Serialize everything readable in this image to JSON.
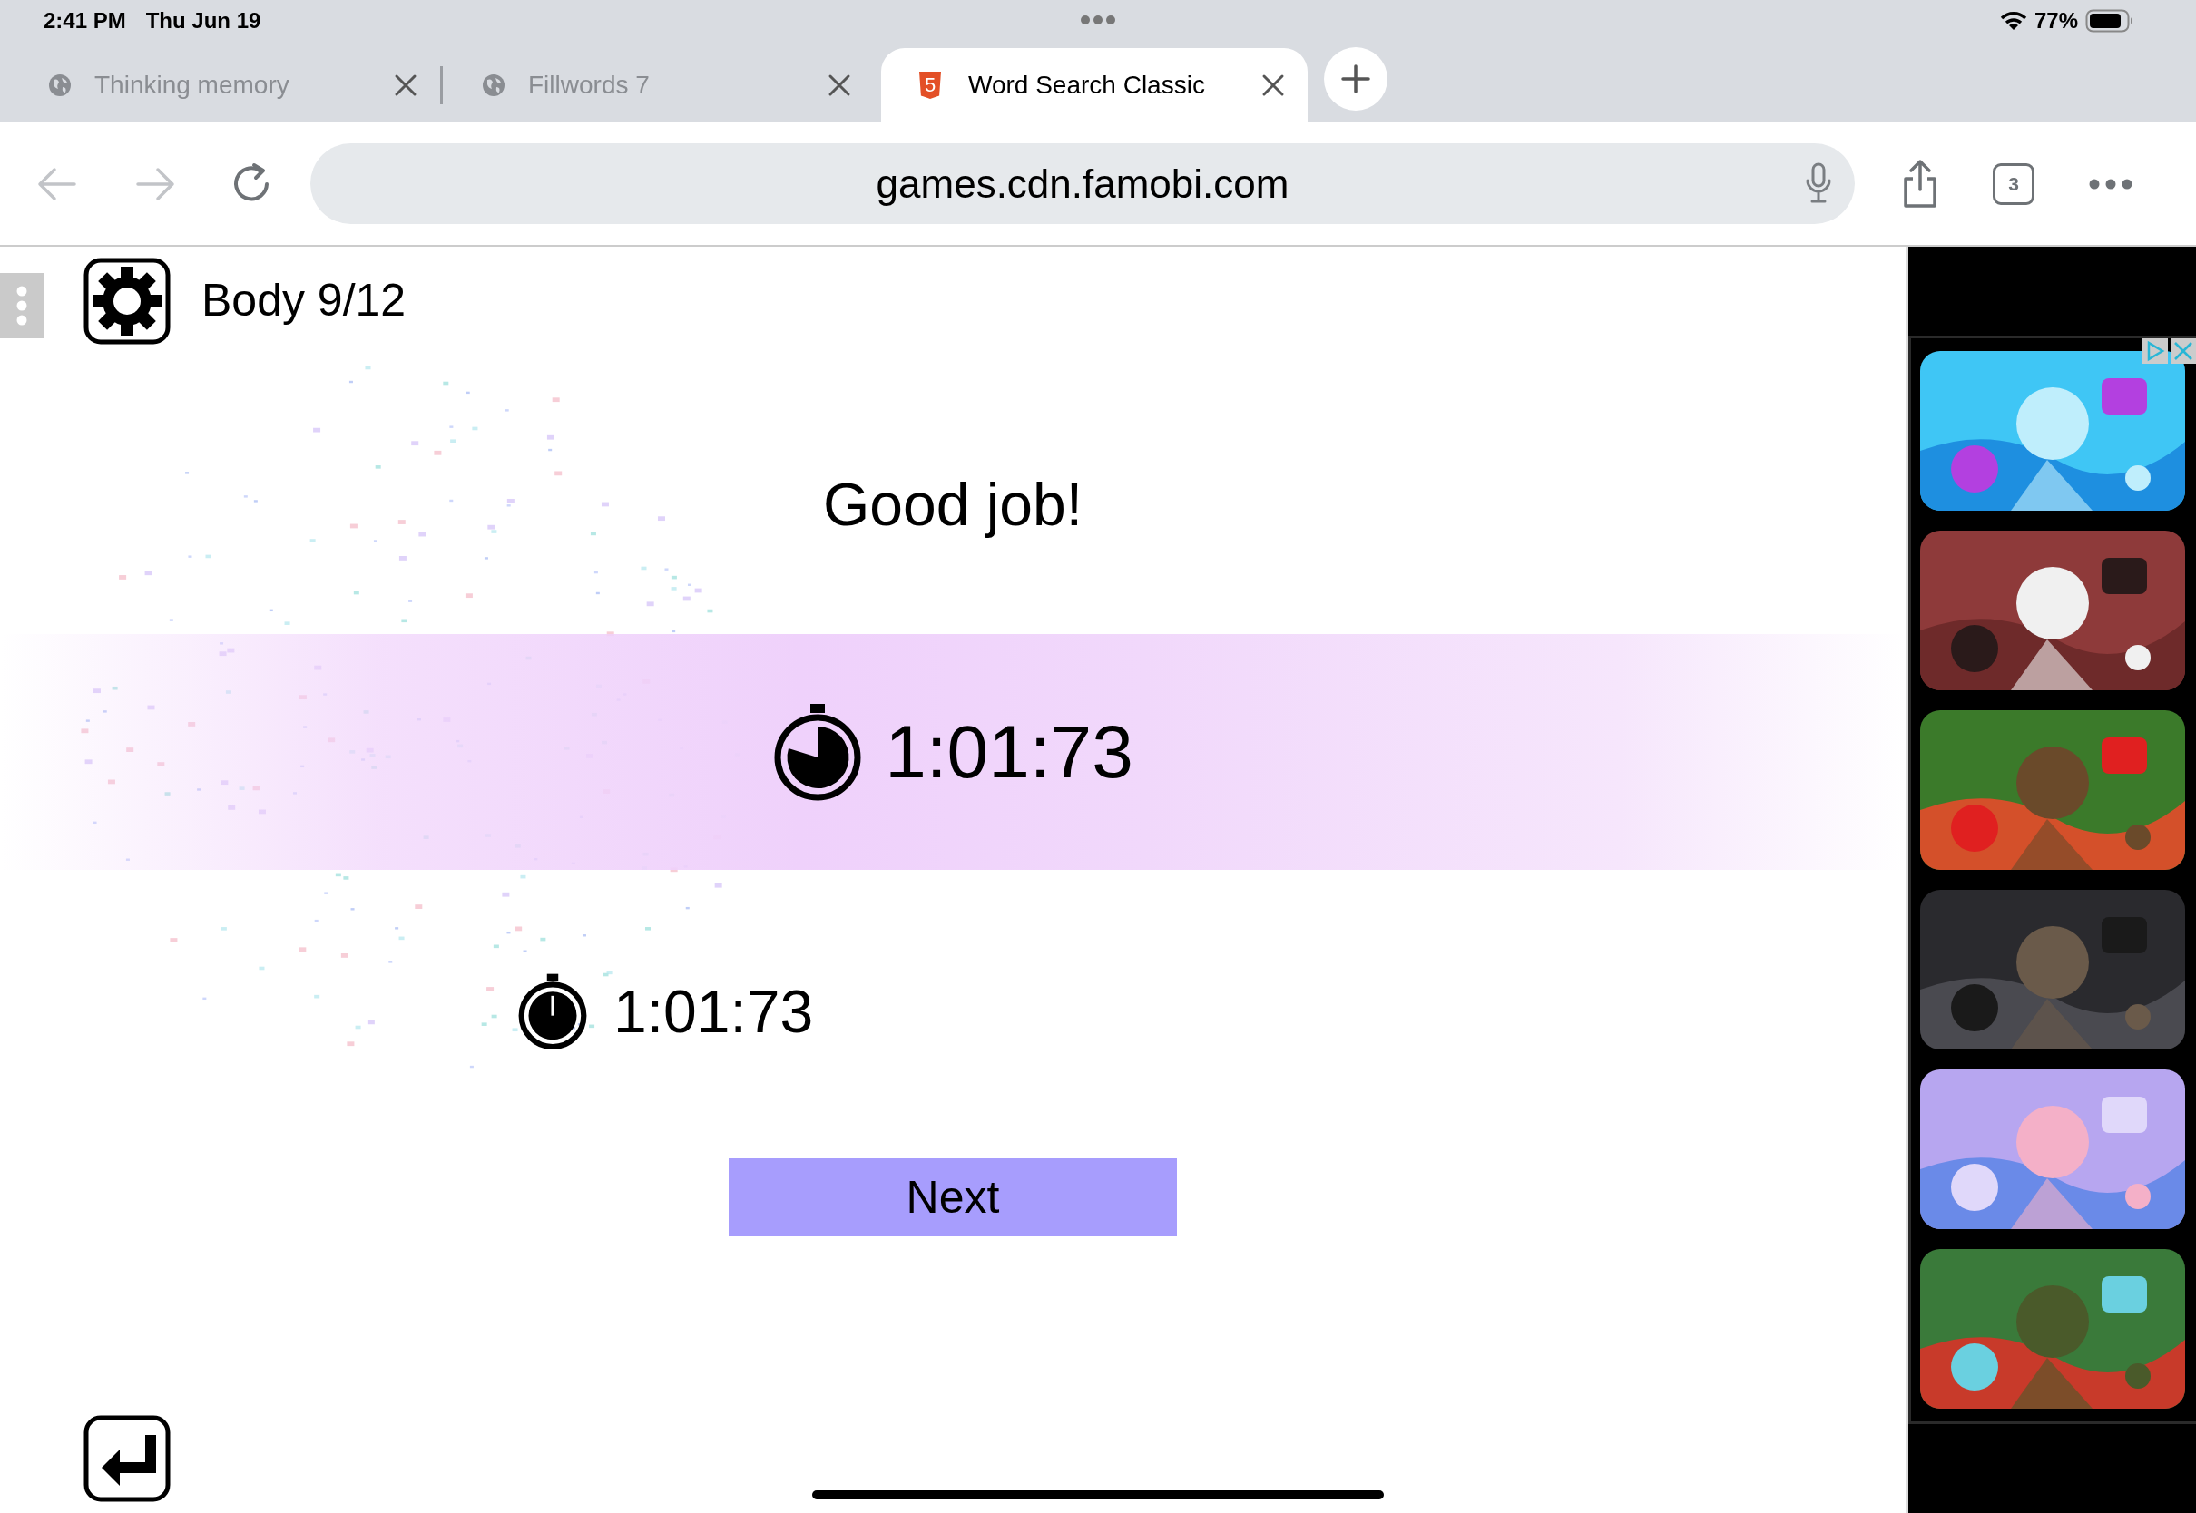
{
  "status_bar": {
    "time": "2:41 PM",
    "date": "Thu Jun 19",
    "battery": "77%"
  },
  "tabs": [
    {
      "title": "Thinking memory",
      "selected": false,
      "kind": "globe"
    },
    {
      "title": "Fillwords 7",
      "selected": false,
      "kind": "globe"
    },
    {
      "title": "Word Search Classic",
      "selected": true,
      "kind": "html5",
      "favicon_text": "5"
    }
  ],
  "address_bar": {
    "url": "games.cdn.famobi.com"
  },
  "toolbar": {
    "tab_count": "3"
  },
  "game": {
    "level_label": "Body 9/12",
    "message": "Good job!",
    "time": "1:01:73",
    "best_time": "1:01:73",
    "next_button": "Next"
  }
}
